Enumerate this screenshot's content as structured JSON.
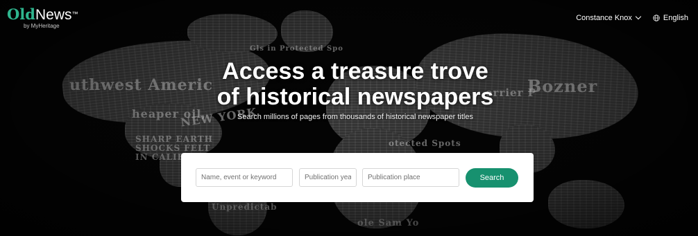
{
  "header": {
    "logo_old": "Old",
    "logo_news": "News",
    "logo_tm": "™",
    "logo_sub": "by MyHeritage",
    "user_name": "Constance Knox",
    "language": "English"
  },
  "hero": {
    "title_line1": "Access a treasure trove",
    "title_line2": "of historical newspapers",
    "subtitle": "Search millions of pages from thousands of historical newspaper titles"
  },
  "search": {
    "keyword_placeholder": "Name, event or keyword",
    "year_placeholder": "Publication year",
    "place_placeholder": "Publication place",
    "button_label": "Search"
  },
  "colors": {
    "accent": "#17916f",
    "logo_green": "#2fb58e",
    "background": "#000000"
  },
  "icons": {
    "user_menu": "chevron-down-icon",
    "language": "globe-icon"
  }
}
